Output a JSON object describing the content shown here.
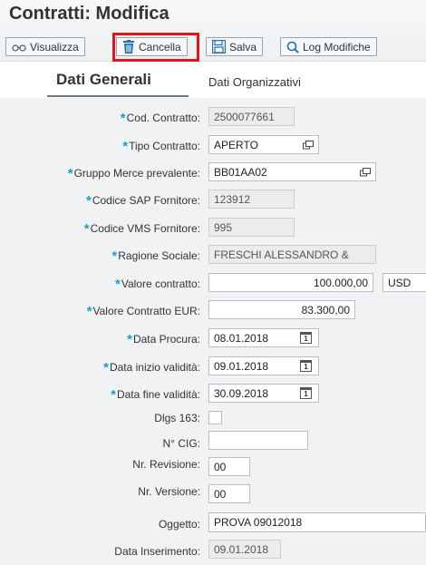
{
  "header": {
    "title": "Contratti: Modifica",
    "toolbar": [
      {
        "label": "Visualizza",
        "icon": "glasses-icon"
      },
      {
        "label": "Cancella",
        "icon": "trash-icon"
      },
      {
        "label": "Salva",
        "icon": "save-icon"
      },
      {
        "label": "Log Modifiche",
        "icon": "search-icon"
      }
    ],
    "highlight_color": "#e3141b"
  },
  "tabs": {
    "active": "Dati Generali",
    "inactive": "Dati Organizzativi"
  },
  "form": {
    "cod_contratto": {
      "label": "Cod. Contratto:",
      "value": "2500077661"
    },
    "tipo_contratto": {
      "label": "Tipo Contratto:",
      "value": "APERTO"
    },
    "gruppo_merce": {
      "label": "Gruppo Merce prevalente:",
      "value": "BB01AA02"
    },
    "codice_sap": {
      "label": "Codice SAP Fornitore:",
      "value": "123912"
    },
    "codice_vms": {
      "label": "Codice VMS Fornitore:",
      "value": "995"
    },
    "ragione_sociale": {
      "label": "Ragione Sociale:",
      "value": "FRESCHI ALESSANDRO &"
    },
    "valore_contratto": {
      "label": "Valore contratto:",
      "value": "100.000,00",
      "currency": "USD"
    },
    "valore_eur": {
      "label": "Valore Contratto EUR:",
      "value": "83.300,00"
    },
    "data_procura": {
      "label": "Data Procura:",
      "value": "08.01.2018"
    },
    "data_inizio": {
      "label": "Data inizio validità:",
      "value": "09.01.2018"
    },
    "data_fine": {
      "label": "Data fine validità:",
      "value": "30.09.2018"
    },
    "dlgs": {
      "label": "Dlgs 163:"
    },
    "cig": {
      "label": "N° CIG:",
      "value": ""
    },
    "revisione": {
      "label": "Nr. Revisione:",
      "value": "00"
    },
    "versione": {
      "label": "Nr. Versione:",
      "value": "00"
    },
    "oggetto": {
      "label": "Oggetto:",
      "value": "PROVA 09012018"
    },
    "data_inserimento": {
      "label": "Data Inserimento:",
      "value": "09.01.2018"
    },
    "required_marker": "*",
    "calendar_day": "1"
  }
}
